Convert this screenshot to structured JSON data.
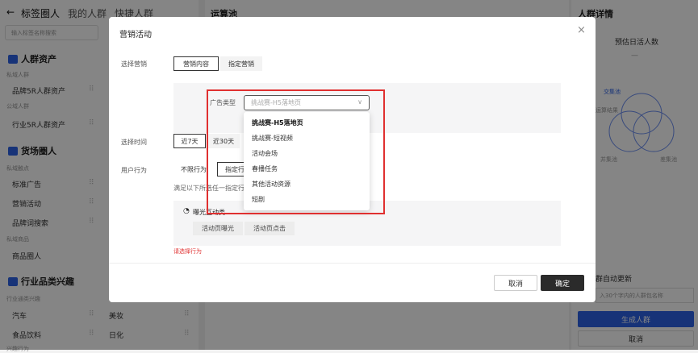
{
  "left": {
    "back_arrow": "←",
    "tabs": [
      {
        "label": "标签圈人"
      },
      {
        "label": "我的人群"
      },
      {
        "label": "快捷人群"
      }
    ],
    "search_placeholder": "输入标签名称搜索",
    "sections": [
      {
        "title": "人群资产",
        "icon_color": "#2d62e6",
        "groups": [
          {
            "label": "私域人群",
            "items": [
              {
                "name": "品牌5R人群资产"
              }
            ]
          },
          {
            "label": "公域人群",
            "items": [
              {
                "name": "行业5R人群资产"
              }
            ]
          }
        ]
      },
      {
        "title": "货场圈人",
        "icon_color": "#2d62e6",
        "groups": [
          {
            "label": "私域触点",
            "items": [
              {
                "name": "标准广告"
              },
              {
                "name": "营销活动"
              },
              {
                "name": "品牌词搜索"
              }
            ]
          },
          {
            "label": "私域商品",
            "items": [
              {
                "name": "商品圈人"
              }
            ]
          }
        ]
      },
      {
        "title": "行业品类兴趣",
        "icon_color": "#2d62e6",
        "groups": [
          {
            "label": "行业通类兴趣",
            "items": [
              {
                "name": "汽车"
              },
              {
                "name": "美妆"
              },
              {
                "name": "食品饮料"
              },
              {
                "name": "日化"
              }
            ]
          }
        ]
      }
    ],
    "bottom_label": "兴趣行为"
  },
  "middle": {
    "title": "运算池"
  },
  "right": {
    "title": "人群详情",
    "stat_label": "预估日活人数",
    "stat_value": "—",
    "venn": {
      "intersection": "交集池",
      "union": "并集池",
      "diff": "差集池",
      "result": "运算结果"
    },
    "auto_update": "群自动更新",
    "name_placeholder": "入30个字内的人群包名称",
    "generate": "生成人群",
    "cancel": "取消"
  },
  "modal": {
    "title": "营销活动",
    "close": "×",
    "select_marketing_label": "选择营销",
    "marketing_tabs": [
      {
        "label": "营销内容"
      },
      {
        "label": "指定营销"
      }
    ],
    "ad_type_label": "广告类型",
    "ad_type_value": "挑战赛-H5落地页",
    "time_label": "选择时间",
    "time_tabs": [
      {
        "label": "近7天"
      },
      {
        "label": "近30天"
      }
    ],
    "behavior_label": "用户行为",
    "behavior_tabs": [
      {
        "label": "不限行为"
      },
      {
        "label": "指定行"
      }
    ],
    "hint": "满足以下所选任一指定行",
    "exposure_title": "曝光互动类",
    "chips": [
      {
        "label": "活动页曝光"
      },
      {
        "label": "活动页点击"
      }
    ],
    "error": "请选择行为",
    "cancel": "取消",
    "ok": "确定"
  },
  "dropdown_options": [
    {
      "label": "挑战赛-H5落地页",
      "selected": true
    },
    {
      "label": "挑战赛-短视频",
      "selected": false
    },
    {
      "label": "活动会场",
      "selected": false
    },
    {
      "label": "春播任务",
      "selected": false
    },
    {
      "label": "其他活动资源",
      "selected": false
    },
    {
      "label": "短剧",
      "selected": false
    }
  ],
  "colors": {
    "accent": "#2d62e6",
    "highlight": "#e03030",
    "primary_button": "#2b2b2b"
  }
}
